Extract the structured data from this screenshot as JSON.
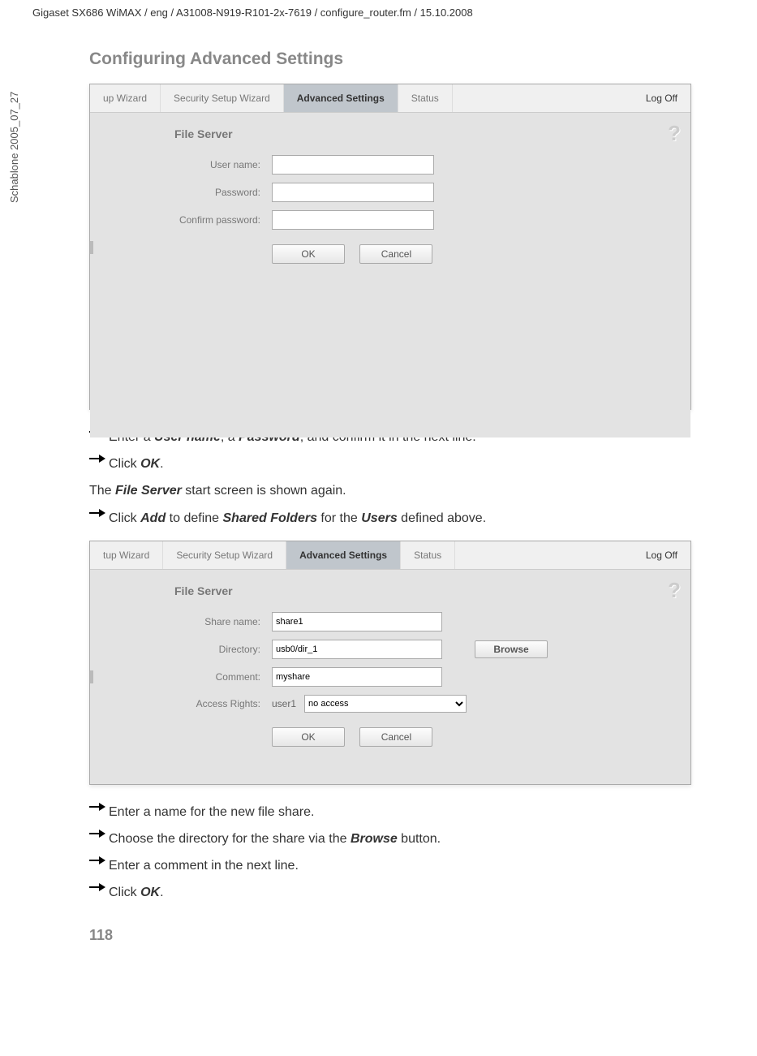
{
  "header_line": "Gigaset SX686 WiMAX / eng / A31008-N919-R101-2x-7619 / configure_router.fm / 15.10.2008",
  "vtext": "Schablone 2005_07_27",
  "section_title": "Configuring Advanced Settings",
  "screenshot1": {
    "tabs": {
      "wizard": "up Wizard",
      "security": "Security Setup Wizard",
      "advanced": "Advanced Settings",
      "status": "Status"
    },
    "logoff": "Log Off",
    "panel_title": "File Server",
    "labels": {
      "username": "User name:",
      "password": "Password:",
      "confirm": "Confirm password:"
    },
    "values": {
      "username": "",
      "password": "",
      "confirm": ""
    },
    "buttons": {
      "ok": "OK",
      "cancel": "Cancel"
    }
  },
  "instructions1": {
    "l1_pre": "Enter a ",
    "l1_b1": "User name",
    "l1_mid1": ", a ",
    "l1_b2": "Password",
    "l1_post": ", and confirm it in the next line.",
    "l2_pre": "Click ",
    "l2_b": "OK",
    "l2_post": ".",
    "l3_pre": "The ",
    "l3_b": "File Server",
    "l3_post": " start screen is shown again.",
    "l4_pre": "Click ",
    "l4_b1": "Add",
    "l4_mid1": " to define ",
    "l4_b2": "Shared Folders",
    "l4_mid2": " for the ",
    "l4_b3": "Users",
    "l4_post": " defined above."
  },
  "screenshot2": {
    "tabs": {
      "wizard": "tup Wizard",
      "security": "Security Setup Wizard",
      "advanced": "Advanced Settings",
      "status": "Status"
    },
    "logoff": "Log Off",
    "panel_title": "File Server",
    "labels": {
      "sharename": "Share name:",
      "directory": "Directory:",
      "comment": "Comment:",
      "access": "Access Rights:"
    },
    "values": {
      "sharename": "share1",
      "directory": "usb0/dir_1",
      "comment": "myshare",
      "access_user": "user1",
      "access_select": "no access"
    },
    "buttons": {
      "browse": "Browse",
      "ok": "OK",
      "cancel": "Cancel"
    }
  },
  "instructions2": {
    "l1": "Enter a name for the new file share.",
    "l2_pre": "Choose the directory for the share via the ",
    "l2_b": "Browse",
    "l2_post": " button.",
    "l3": "Enter a comment in the next line.",
    "l4_pre": "Click ",
    "l4_b": "OK",
    "l4_post": "."
  },
  "page_number": "118"
}
